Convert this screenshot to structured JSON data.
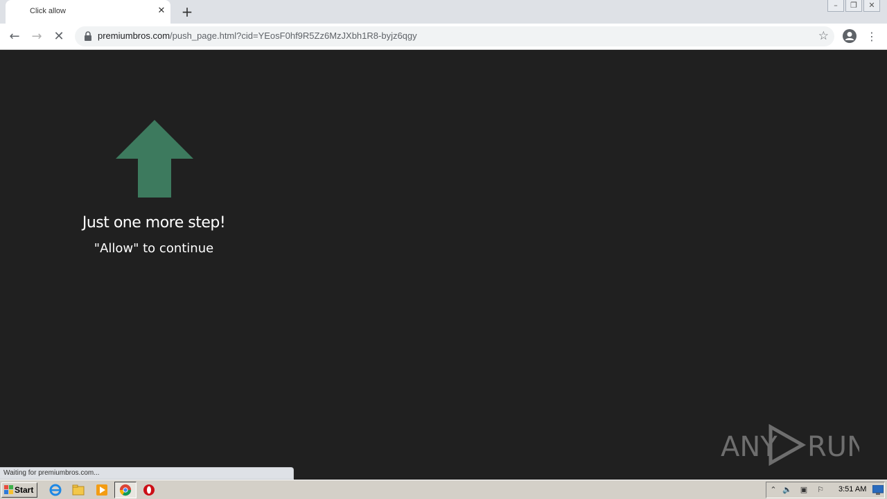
{
  "browser": {
    "tab": {
      "title": "Click allow",
      "close_glyph": "✕"
    },
    "new_tab_glyph": "+",
    "window_controls": [
      "–",
      "❐",
      "✕"
    ],
    "nav": {
      "back_glyph": "←",
      "forward_glyph": "→",
      "stop_glyph": "✕"
    },
    "address": {
      "host": "premiumbros.com",
      "path": "/push_page.html?cid=YEosF0hf9R5Zz6MzJXbh1R8-byjz6qgy"
    },
    "bookmark_glyph": "☆",
    "menu_glyph": "⋮"
  },
  "page": {
    "arrow_color": "#3d7a5e",
    "heading": "Just one more step!",
    "subheading": "\"Allow\" to continue"
  },
  "status_text": "Waiting for premiumbros.com...",
  "watermark": {
    "text_left": "ANY",
    "text_right": "RUN"
  },
  "taskbar": {
    "start_label": "Start",
    "apps": [
      "ie-icon",
      "explorer-icon",
      "media-player-icon",
      "chrome-icon",
      "opera-icon"
    ],
    "clock": "3:51 AM"
  }
}
